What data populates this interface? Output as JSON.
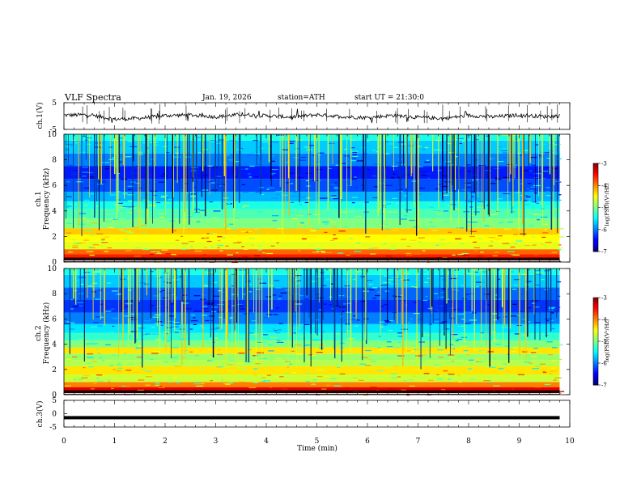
{
  "header": {
    "title": "VLF Spectra",
    "date": "Jan. 19, 2026",
    "station": "station=ATH",
    "start": "start UT =  21:30:0"
  },
  "chart_data": [
    {
      "type": "line",
      "title": "",
      "ylabel": "ch.1(V)",
      "ylim": [
        -5,
        5
      ],
      "yticks": [
        "5",
        "-5"
      ],
      "xlim": [
        0,
        10
      ],
      "x": [
        0,
        0.5,
        1,
        1.5,
        2,
        2.5,
        3,
        3.5,
        4,
        4.5,
        5,
        5.5,
        6,
        6.5,
        7,
        7.5,
        8,
        8.5,
        9,
        9.5,
        9.8
      ],
      "values": [
        0.3,
        0.5,
        -1.2,
        -0.8,
        0.2,
        0.4,
        -0.3,
        0.6,
        0.1,
        -0.4,
        0.5,
        -0.2,
        -0.6,
        0.3,
        -0.5,
        -0.9,
        0.2,
        -0.3,
        0.4,
        -0.2,
        0.1
      ]
    },
    {
      "type": "heatmap",
      "title": "",
      "ylabel": "Frequency (kHz)",
      "channel_label": "ch.1",
      "yticks": [
        "0",
        "2",
        "4",
        "6",
        "8",
        "10"
      ],
      "ylim": [
        0,
        10
      ],
      "xlim": [
        0,
        10
      ],
      "data_xmax": 9.8,
      "colorbar": {
        "label": "log(PSD)(V²/Hz)",
        "ticks": [
          "-3",
          "-4",
          "-5",
          "-6",
          "-7"
        ],
        "range": [
          -7,
          -3
        ]
      },
      "bands": [
        {
          "f": 0.4,
          "psd": -3.6
        },
        {
          "f": 0.8,
          "psd": -3.9
        },
        {
          "f": 1.2,
          "psd": -4.6
        },
        {
          "f": 2.0,
          "psd": -4.5
        },
        {
          "f": 2.3,
          "psd": -4.3
        },
        {
          "f": 3.0,
          "psd": -5.0
        },
        {
          "f": 3.8,
          "psd": -5.2
        },
        {
          "f": 4.5,
          "psd": -5.4
        },
        {
          "f": 5.0,
          "psd": -5.8
        },
        {
          "f": 6.0,
          "psd": -6.2
        },
        {
          "f": 7.0,
          "psd": -6.4
        },
        {
          "f": 8.0,
          "psd": -6.0
        },
        {
          "f": 9.0,
          "psd": -5.7
        },
        {
          "f": 10.0,
          "psd": -5.4
        }
      ]
    },
    {
      "type": "heatmap",
      "title": "",
      "ylabel": "Frequency (kHz)",
      "channel_label": "ch.2",
      "yticks": [
        "0",
        "2",
        "4",
        "6",
        "8",
        "10"
      ],
      "ylim": [
        0,
        10
      ],
      "xlim": [
        0,
        10
      ],
      "data_xmax": 9.8,
      "colorbar": {
        "label": "log(PSD)(V²/Hz)",
        "ticks": [
          "-3",
          "-4",
          "-5",
          "-6",
          "-7"
        ],
        "range": [
          -7,
          -3
        ]
      },
      "bands": [
        {
          "f": 0.4,
          "psd": -3.4
        },
        {
          "f": 0.8,
          "psd": -4.0
        },
        {
          "f": 1.2,
          "psd": -4.7
        },
        {
          "f": 2.0,
          "psd": -4.4
        },
        {
          "f": 2.5,
          "psd": -4.8
        },
        {
          "f": 3.0,
          "psd": -4.9
        },
        {
          "f": 3.5,
          "psd": -4.4
        },
        {
          "f": 4.0,
          "psd": -5.0
        },
        {
          "f": 4.6,
          "psd": -5.3
        },
        {
          "f": 5.2,
          "psd": -5.6
        },
        {
          "f": 6.0,
          "psd": -6.0
        },
        {
          "f": 7.0,
          "psd": -6.3
        },
        {
          "f": 8.0,
          "psd": -6.1
        },
        {
          "f": 9.0,
          "psd": -5.7
        },
        {
          "f": 10.0,
          "psd": -5.4
        }
      ]
    },
    {
      "type": "line",
      "title": "",
      "ylabel": "ch.3(V)",
      "ylim": [
        -5,
        5
      ],
      "yticks": [
        "5",
        "0",
        "-5"
      ],
      "xlim": [
        0,
        10
      ],
      "x": [
        0,
        9.8
      ],
      "values": [
        -1.5,
        -1.5
      ]
    }
  ],
  "xaxis": {
    "label": "Time (min)",
    "ticks": [
      "0",
      "1",
      "2",
      "3",
      "4",
      "5",
      "6",
      "7",
      "8",
      "9",
      "10"
    ]
  }
}
